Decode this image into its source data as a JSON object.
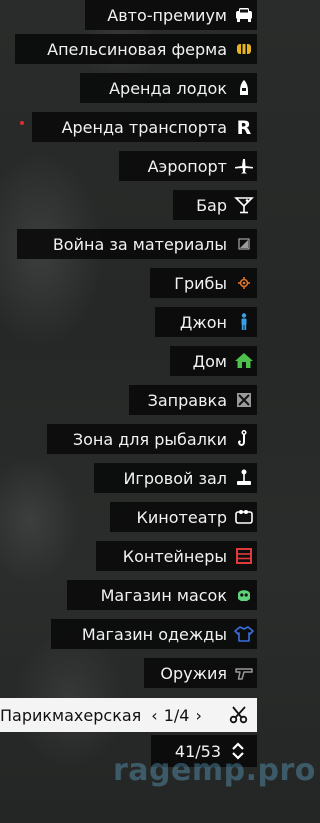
{
  "blip_list": {
    "items": [
      {
        "label": "Авто-премиум",
        "icon": "car-icon"
      },
      {
        "label": "Апельсиновая ферма",
        "icon": "orange-farm-icon",
        "icon_color": "#e6b422"
      },
      {
        "label": "Аренда лодок",
        "icon": "boat-icon"
      },
      {
        "label": "Аренда транспорта",
        "icon": "letter-r-icon"
      },
      {
        "label": "Аэропорт",
        "icon": "airplane-icon"
      },
      {
        "label": "Бар",
        "icon": "cocktail-icon"
      },
      {
        "label": "Война за материалы",
        "icon": "materials-war-icon"
      },
      {
        "label": "Грибы",
        "icon": "mushroom-icon",
        "icon_color": "#d9742b"
      },
      {
        "label": "Джон",
        "icon": "person-icon",
        "icon_color": "#3aa0e8"
      },
      {
        "label": "Дом",
        "icon": "house-icon",
        "icon_color": "#4cc24c"
      },
      {
        "label": "Заправка",
        "icon": "gas-station-icon"
      },
      {
        "label": "Зона для рыбалки",
        "icon": "fishing-hook-icon"
      },
      {
        "label": "Игровой зал",
        "icon": "joystick-icon"
      },
      {
        "label": "Кинотеатр",
        "icon": "camera-icon"
      },
      {
        "label": "Контейнеры",
        "icon": "container-icon",
        "icon_color": "#e03b3b"
      },
      {
        "label": "Магазин масок",
        "icon": "mask-icon",
        "icon_color": "#5fd47a"
      },
      {
        "label": "Магазин одежды",
        "icon": "tshirt-icon",
        "icon_color": "#3b6fe0"
      },
      {
        "label": "Оружия",
        "icon": "pistol-icon"
      }
    ],
    "selected": {
      "label": "Парикмахерская",
      "prev": "‹",
      "next": "›",
      "page": "1/4",
      "icon": "scissors-icon"
    },
    "counter": "41/53"
  },
  "watermark": "ragemp.pro"
}
